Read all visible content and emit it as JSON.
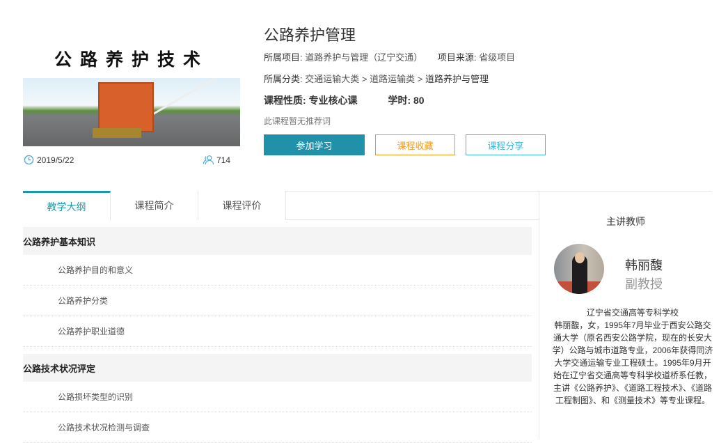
{
  "cover": {
    "image_text": "公路养护技术",
    "date": "2019/5/22",
    "learners": "714"
  },
  "course": {
    "title": "公路养护管理",
    "project_label": "所属项目:",
    "project_value": "道路养护与管理（辽宁交通）",
    "source_label": "项目来源:",
    "source_value": "省级项目",
    "category_label": "所属分类:",
    "category_path": [
      "交通运输大类",
      "道路运输类",
      "道路养护与管理"
    ],
    "category_sep": ">",
    "nature_label": "课程性质:",
    "nature_value": "专业核心课",
    "hours_label": "学时:",
    "hours_value": "80",
    "recommend": "此课程暂无推荐词"
  },
  "buttons": {
    "join": "参加学习",
    "favorite": "课程收藏",
    "share": "课程分享"
  },
  "colors": {
    "primary": "#2190a9",
    "orange": "#f39b1d",
    "cyan": "#3db8db",
    "tab_accent": "#1a9aa0"
  },
  "tabs": [
    {
      "label": "教学大纲",
      "active": true
    },
    {
      "label": "课程简介"
    },
    {
      "label": "课程评价"
    }
  ],
  "outline": [
    {
      "title": "公路养护基本知识",
      "items": [
        "公路养护目的和意义",
        "公路养护分类",
        "公路养护职业道德"
      ]
    },
    {
      "title": "公路技术状况评定",
      "items": [
        "公路损坏类型的识别",
        "公路技术状况检测与调查"
      ]
    }
  ],
  "teacher": {
    "heading": "主讲教师",
    "name": "韩丽馥",
    "title": "副教授",
    "school": "辽宁省交通高等专科学校",
    "bio": "韩丽馥，女，1995年7月毕业于西安公路交通大学（原名西安公路学院，现在的长安大学）公路与城市道路专业，2006年获得同济大学交通运输专业工程硕士。1995年9月开始在辽宁省交通高等专科学校道桥系任教，主讲《公路养护》、《道路工程技术》、《道路工程制图》、和《测量技术》等专业课程。"
  }
}
